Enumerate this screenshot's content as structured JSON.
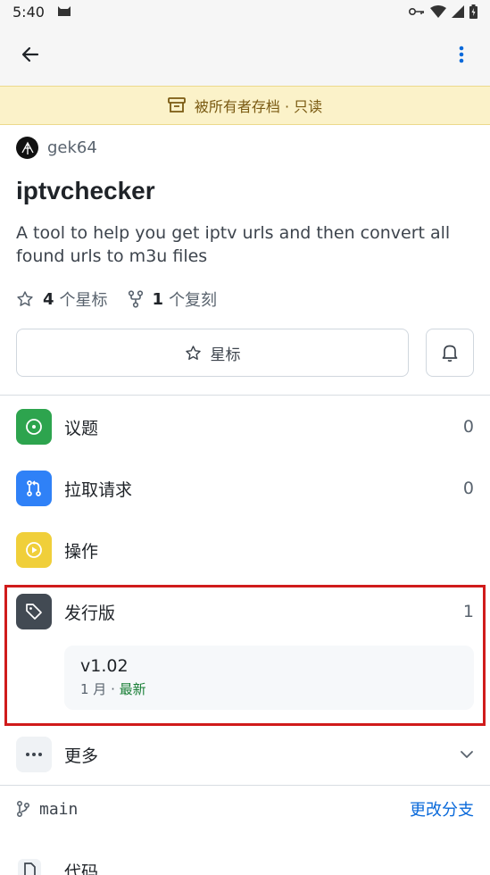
{
  "status": {
    "time": "5:40"
  },
  "banner": {
    "text": "被所有者存档 · 只读"
  },
  "repo": {
    "owner": "gek64",
    "name": "iptvchecker",
    "description": "A tool to help you get iptv urls and then convert all found urls to m3u files",
    "stars_count": "4",
    "stars_label": "个星标",
    "forks_count": "1",
    "forks_label": "个复刻"
  },
  "actions": {
    "star_label": "星标"
  },
  "menu": {
    "issues": {
      "label": "议题",
      "count": "0",
      "color": "#2da44e"
    },
    "pulls": {
      "label": "拉取请求",
      "count": "0",
      "color": "#2f81f7"
    },
    "actions": {
      "label": "操作",
      "color": "#f0cf3a"
    },
    "releases": {
      "label": "发行版",
      "count": "1",
      "color": "#424a53"
    },
    "more": {
      "label": "更多"
    }
  },
  "release": {
    "tag": "v1.02",
    "date": "1 月",
    "separator": " · ",
    "latest": "最新"
  },
  "branch": {
    "name": "main",
    "change_label": "更改分支"
  },
  "code": {
    "label": "代码"
  }
}
